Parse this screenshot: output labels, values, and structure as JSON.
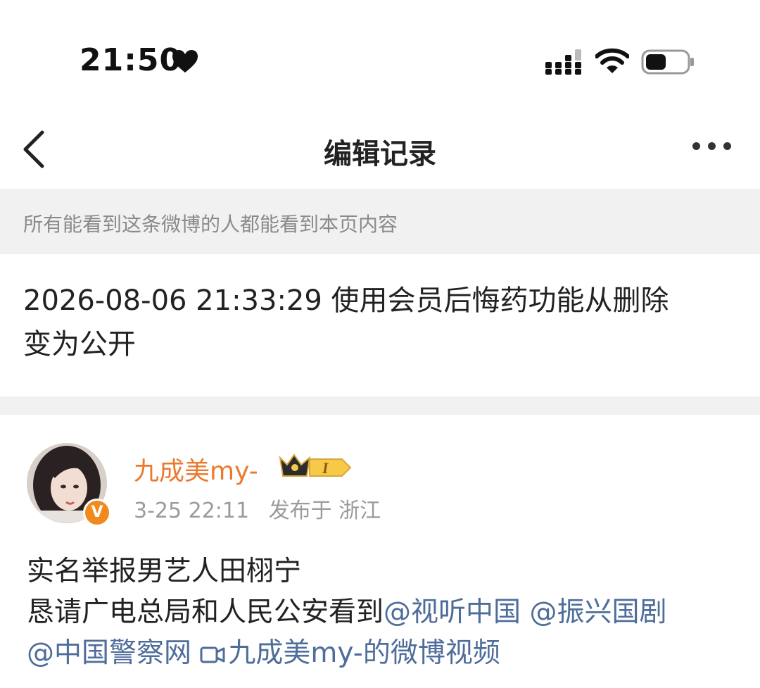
{
  "status_bar": {
    "time": "21:50",
    "icons": [
      "heart-icon",
      "signal-icon",
      "wifi-icon",
      "battery-icon"
    ]
  },
  "nav": {
    "title": "编辑记录",
    "back_icon": "chevron-left-icon",
    "more_icon": "more-icon"
  },
  "notice": "所有能看到这条微博的人都能看到本页内容",
  "record": {
    "text_line1": "2026-08-06 21:33:29 使用会员后悔药功能从删除",
    "text_line2": "变为公开"
  },
  "post": {
    "username": "九成美my-",
    "member_badge": "I",
    "verified_badge": "V",
    "time": "3-25 22:11",
    "location": "发布于 浙江",
    "line1": "实名举报男艺人田栩宁",
    "line2_text": "恳请广电总局和人民公安看到",
    "mention1": "@视听中国",
    "mention2": "@振兴国剧",
    "mention3": "@中国警察网",
    "video_link": "九成美my-的微博视频"
  },
  "colors": {
    "username": "#eb7a2f",
    "link": "#4f6d9b",
    "notice_bg": "#f1f1f1",
    "verified": "#f08a1c"
  }
}
